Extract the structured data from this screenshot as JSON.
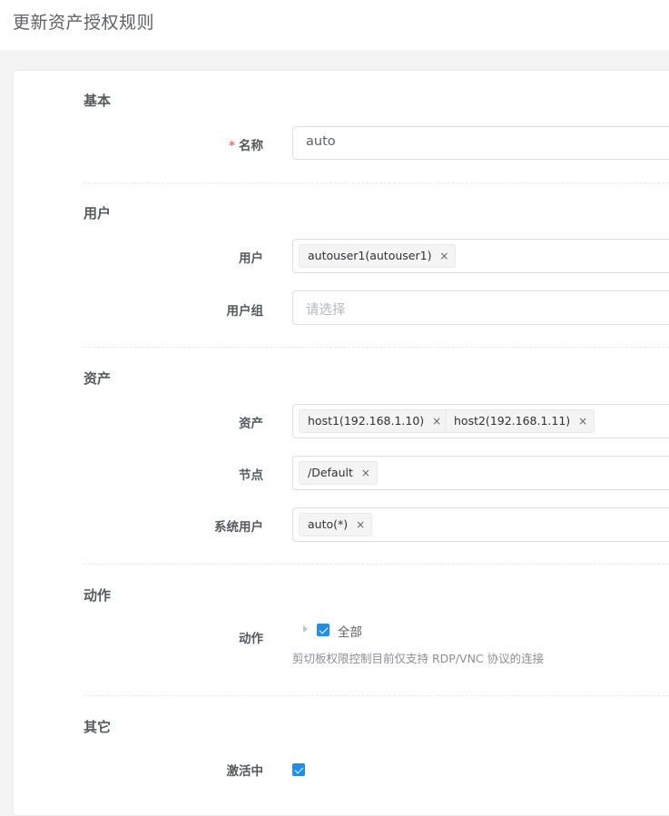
{
  "page": {
    "title": "更新资产授权规则"
  },
  "sections": {
    "basic": {
      "title": "基本"
    },
    "user": {
      "title": "用户"
    },
    "asset": {
      "title": "资产"
    },
    "action": {
      "title": "动作"
    },
    "other": {
      "title": "其它"
    }
  },
  "form": {
    "name": {
      "label": "名称",
      "required_mark": "*",
      "value": "auto"
    },
    "users": {
      "label": "用户",
      "tags": [
        "autouser1(autouser1)"
      ]
    },
    "user_groups": {
      "label": "用户组",
      "placeholder": "请选择"
    },
    "assets": {
      "label": "资产",
      "tags": [
        "host1(192.168.1.10)",
        "host2(192.168.1.11)"
      ]
    },
    "nodes": {
      "label": "节点",
      "tags": [
        "/Default"
      ]
    },
    "system_users": {
      "label": "系统用户",
      "tags": [
        "auto(*)"
      ]
    },
    "actions": {
      "label": "动作",
      "tree_item": "全部",
      "checked": true,
      "help": "剪切板权限控制目前仅支持 RDP/VNC 协议的连接"
    },
    "is_active": {
      "label": "激活中",
      "checked": true
    }
  },
  "icons": {
    "tag_close": "×"
  },
  "colors": {
    "accent": "#1f8feb",
    "required": "#f56c6c"
  }
}
